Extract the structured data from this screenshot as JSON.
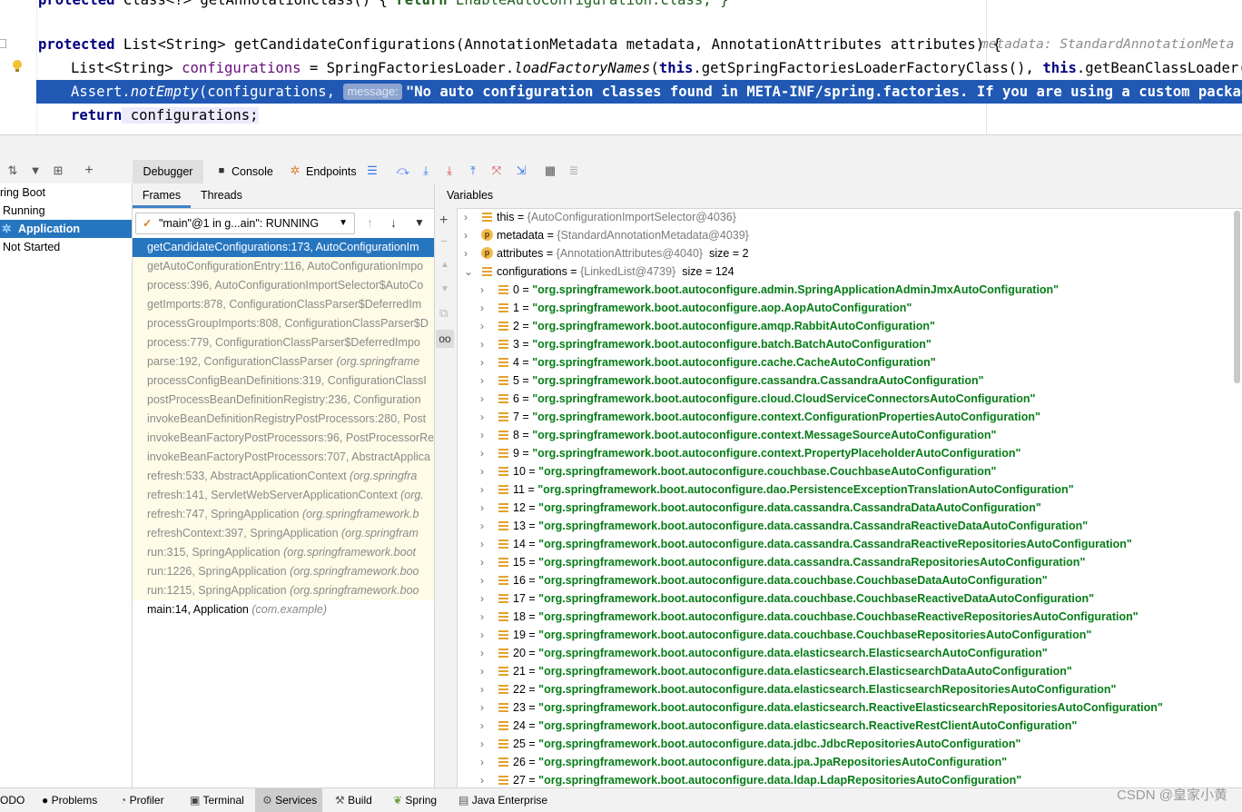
{
  "editor": {
    "line0": {
      "kw": "protected",
      "rest": " Class<?> getAnnotationClass() { ",
      "kw2": "return",
      "rest2": " EnableAutoConfiguration.class; }"
    },
    "line1": {
      "kw": "protected",
      "sig": " List<String> getCandidateConfigurations(AnnotationMetadata metadata, AnnotationAttributes attributes) {",
      "hint": "metadata: StandardAnnotationMeta"
    },
    "line2": {
      "pre": "List<String> ",
      "var": "configurations",
      "mid": " = SpringFactoriesLoader.",
      "call": "loadFactoryNames",
      "open": "(",
      "this1": "this",
      "a1": ".getSpringFactoriesLoaderFactoryClass(), ",
      "this2": "this",
      "a2": ".getBeanClassLoader());"
    },
    "line3": {
      "pre": "Assert.",
      "call": "notEmpty",
      "args": "(configurations, ",
      "hint": "message:",
      "str": "\"No auto configuration classes found in META-INF/spring.factories. If you are using a custom packaging,"
    },
    "line4": {
      "kw": "return",
      "rest": " configurations;"
    }
  },
  "toolbar": {
    "debugger": "Debugger",
    "console": "Console",
    "endpoints": "Endpoints"
  },
  "services": {
    "items": [
      "ring Boot",
      "Running",
      "Application",
      "Not Started"
    ]
  },
  "frames": {
    "tab_frames": "Frames",
    "tab_threads": "Threads",
    "thread_combo": "\"main\"@1 in g...ain\": RUNNING",
    "rows": [
      {
        "m": "getCandidateConfigurations:173, AutoConfigurationIm",
        "p": ""
      },
      {
        "m": "getAutoConfigurationEntry:116, AutoConfigurationImpo",
        "p": ""
      },
      {
        "m": "process:396, AutoConfigurationImportSelector$AutoCo",
        "p": ""
      },
      {
        "m": "getImports:878, ConfigurationClassParser$DeferredIm",
        "p": ""
      },
      {
        "m": "processGroupImports:808, ConfigurationClassParser$D",
        "p": ""
      },
      {
        "m": "process:779, ConfigurationClassParser$DeferredImpo",
        "p": ""
      },
      {
        "m": "parse:192, ConfigurationClassParser ",
        "p": "(org.springframe"
      },
      {
        "m": "processConfigBeanDefinitions:319, ConfigurationClassI",
        "p": ""
      },
      {
        "m": "postProcessBeanDefinitionRegistry:236, Configuration",
        "p": ""
      },
      {
        "m": "invokeBeanDefinitionRegistryPostProcessors:280, Post",
        "p": ""
      },
      {
        "m": "invokeBeanFactoryPostProcessors:96, PostProcessorRe",
        "p": ""
      },
      {
        "m": "invokeBeanFactoryPostProcessors:707, AbstractApplica",
        "p": ""
      },
      {
        "m": "refresh:533, AbstractApplicationContext ",
        "p": "(org.springfra"
      },
      {
        "m": "refresh:141, ServletWebServerApplicationContext ",
        "p": "(org."
      },
      {
        "m": "refresh:747, SpringApplication ",
        "p": "(org.springframework.b"
      },
      {
        "m": "refreshContext:397, SpringApplication ",
        "p": "(org.springfram"
      },
      {
        "m": "run:315, SpringApplication ",
        "p": "(org.springframework.boot"
      },
      {
        "m": "run:1226, SpringApplication ",
        "p": "(org.springframework.boo"
      },
      {
        "m": "run:1215, SpringApplication ",
        "p": "(org.springframework.boo"
      },
      {
        "m": "main:14, Application ",
        "p": "(com.example)"
      }
    ]
  },
  "variables": {
    "tab": "Variables",
    "top": [
      {
        "name": "this",
        "val": "{AutoConfigurationImportSelector@4036}",
        "extra": ""
      },
      {
        "name": "metadata",
        "val": "{StandardAnnotationMetadata@4039}",
        "extra": ""
      },
      {
        "name": "attributes",
        "val": "{AnnotationAttributes@4040}",
        "extra": "size = 2"
      },
      {
        "name": "configurations",
        "val": "{LinkedList@4739}",
        "extra": "size = 124"
      }
    ],
    "items": [
      "org.springframework.boot.autoconfigure.admin.SpringApplicationAdminJmxAutoConfiguration",
      "org.springframework.boot.autoconfigure.aop.AopAutoConfiguration",
      "org.springframework.boot.autoconfigure.amqp.RabbitAutoConfiguration",
      "org.springframework.boot.autoconfigure.batch.BatchAutoConfiguration",
      "org.springframework.boot.autoconfigure.cache.CacheAutoConfiguration",
      "org.springframework.boot.autoconfigure.cassandra.CassandraAutoConfiguration",
      "org.springframework.boot.autoconfigure.cloud.CloudServiceConnectorsAutoConfiguration",
      "org.springframework.boot.autoconfigure.context.ConfigurationPropertiesAutoConfiguration",
      "org.springframework.boot.autoconfigure.context.MessageSourceAutoConfiguration",
      "org.springframework.boot.autoconfigure.context.PropertyPlaceholderAutoConfiguration",
      "org.springframework.boot.autoconfigure.couchbase.CouchbaseAutoConfiguration",
      "org.springframework.boot.autoconfigure.dao.PersistenceExceptionTranslationAutoConfiguration",
      "org.springframework.boot.autoconfigure.data.cassandra.CassandraDataAutoConfiguration",
      "org.springframework.boot.autoconfigure.data.cassandra.CassandraReactiveDataAutoConfiguration",
      "org.springframework.boot.autoconfigure.data.cassandra.CassandraReactiveRepositoriesAutoConfiguration",
      "org.springframework.boot.autoconfigure.data.cassandra.CassandraRepositoriesAutoConfiguration",
      "org.springframework.boot.autoconfigure.data.couchbase.CouchbaseDataAutoConfiguration",
      "org.springframework.boot.autoconfigure.data.couchbase.CouchbaseReactiveDataAutoConfiguration",
      "org.springframework.boot.autoconfigure.data.couchbase.CouchbaseReactiveRepositoriesAutoConfiguration",
      "org.springframework.boot.autoconfigure.data.couchbase.CouchbaseRepositoriesAutoConfiguration",
      "org.springframework.boot.autoconfigure.data.elasticsearch.ElasticsearchAutoConfiguration",
      "org.springframework.boot.autoconfigure.data.elasticsearch.ElasticsearchDataAutoConfiguration",
      "org.springframework.boot.autoconfigure.data.elasticsearch.ElasticsearchRepositoriesAutoConfiguration",
      "org.springframework.boot.autoconfigure.data.elasticsearch.ReactiveElasticsearchRepositoriesAutoConfiguration",
      "org.springframework.boot.autoconfigure.data.elasticsearch.ReactiveRestClientAutoConfiguration",
      "org.springframework.boot.autoconfigure.data.jdbc.JdbcRepositoriesAutoConfiguration",
      "org.springframework.boot.autoconfigure.data.jpa.JpaRepositoriesAutoConfiguration",
      "org.springframework.boot.autoconfigure.data.ldap.LdapRepositoriesAutoConfiguration"
    ]
  },
  "bottom": {
    "items": [
      "ODO",
      "Problems",
      "Profiler",
      "Terminal",
      "Services",
      "Build",
      "Spring",
      "Java Enterprise"
    ],
    "watermark": "CSDN @皇家小黄"
  },
  "colors": {
    "selection": "#2675bf",
    "editor_highlight": "#2058b4",
    "string_value": "#067d17"
  }
}
